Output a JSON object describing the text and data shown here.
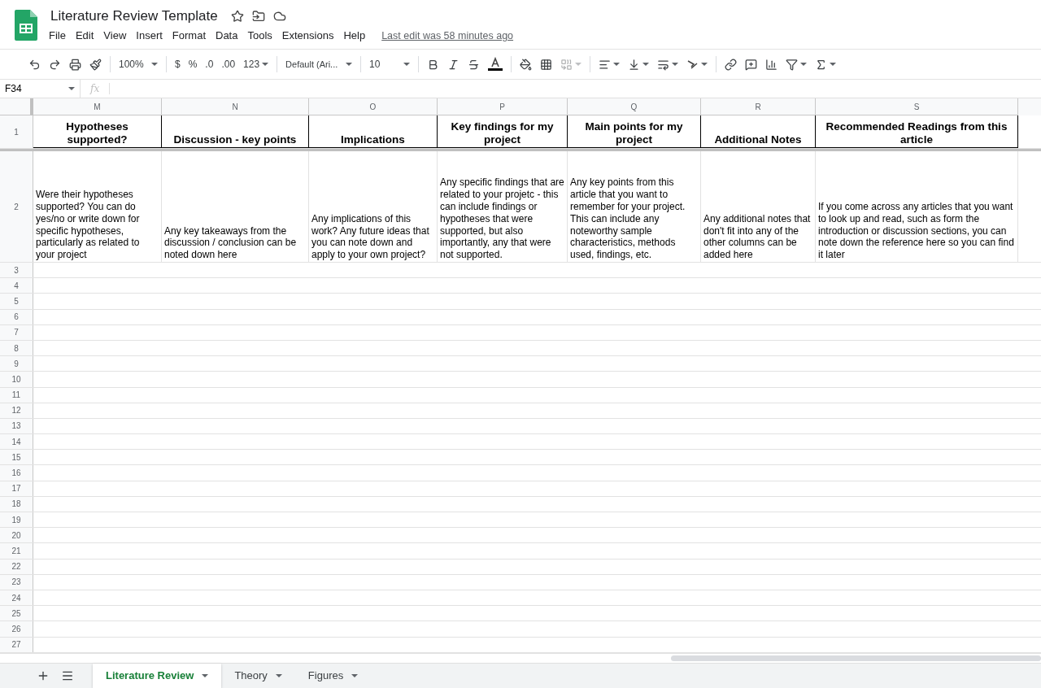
{
  "document": {
    "title": "Literature Review Template",
    "last_edit": "Last edit was 58 minutes ago"
  },
  "menu": [
    "File",
    "Edit",
    "View",
    "Insert",
    "Format",
    "Data",
    "Tools",
    "Extensions",
    "Help"
  ],
  "toolbar": {
    "zoom": "100%",
    "currency": "$",
    "percent": "%",
    "decrease_decimals": ".0",
    "increase_decimals": ".00",
    "number_format": "123",
    "font": "Default (Ari...",
    "font_size": "10"
  },
  "formula_bar": {
    "cell": "F34",
    "fx": "fx"
  },
  "columns": [
    "M",
    "N",
    "O",
    "P",
    "Q",
    "R",
    "S"
  ],
  "rows": [
    {
      "number": "1",
      "kind": "header",
      "cells": [
        "Hypotheses supported?",
        "Discussion - key points",
        "Implications",
        "Key findings for my project",
        "Main points for my project",
        "Additional Notes",
        "Recommended Readings from this article"
      ]
    },
    {
      "number": "2",
      "kind": "text",
      "cells": [
        "Were their hypotheses supported? You can do yes/no or write down for specific hypotheses, particularly as related to your project",
        "Any key takeaways from the discussion / conclusion can be noted down here",
        "Any implications of this work? Any future ideas that you can note down and apply to your own project?",
        "Any specific findings that are related to your projetc - this can include findings or hypotheses that were supported, but also importantly, any that were not supported.",
        "Any key points from this article that you want to remember for your project. This can include any noteworthy sample characteristics, methods used, findings, etc.",
        "Any additional notes that don't fit into any of the other columns can be added here",
        "If you come across any articles that you want to look up and read, such as form the introduction or discussion sections, you can note down the reference here so you can find it later"
      ]
    },
    {
      "number": "3"
    },
    {
      "number": "4"
    },
    {
      "number": "5"
    },
    {
      "number": "6"
    },
    {
      "number": "7"
    },
    {
      "number": "8"
    },
    {
      "number": "9"
    },
    {
      "number": "10"
    },
    {
      "number": "11"
    },
    {
      "number": "12"
    },
    {
      "number": "13"
    },
    {
      "number": "14"
    },
    {
      "number": "15"
    },
    {
      "number": "16"
    },
    {
      "number": "17"
    },
    {
      "number": "18"
    },
    {
      "number": "19"
    },
    {
      "number": "20"
    },
    {
      "number": "21"
    },
    {
      "number": "22"
    },
    {
      "number": "23"
    },
    {
      "number": "24"
    },
    {
      "number": "25"
    },
    {
      "number": "26"
    },
    {
      "number": "27"
    }
  ],
  "sheet_tabs": [
    {
      "label": "Literature Review",
      "selected": true
    },
    {
      "label": "Theory",
      "selected": false
    },
    {
      "label": "Figures",
      "selected": false
    }
  ]
}
